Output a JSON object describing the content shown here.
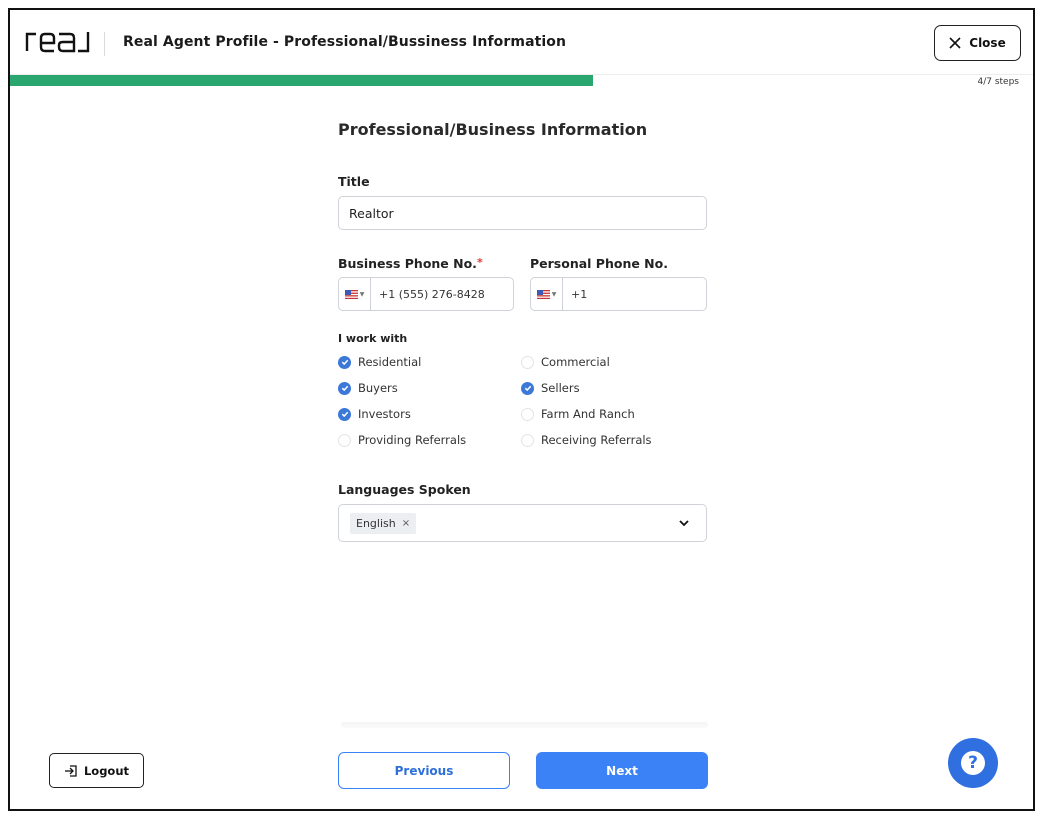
{
  "header": {
    "logo_text": "real",
    "title": "Real Agent Profile - Professional/Bussiness Information",
    "close_label": "Close"
  },
  "progress": {
    "current_step": 4,
    "total_steps": 7,
    "label": "4/7 steps",
    "fraction": 0.57
  },
  "form": {
    "section_title": "Professional/Business Information",
    "title_field": {
      "label": "Title",
      "value": "Realtor"
    },
    "business_phone": {
      "label": "Business Phone No.",
      "required_mark": "*",
      "value": "+1 (555) 276-8428",
      "country": "US"
    },
    "personal_phone": {
      "label": "Personal Phone No.",
      "value": "+1",
      "country": "US"
    },
    "work_with": {
      "label": "I work with",
      "options": [
        {
          "label": "Residential",
          "checked": true
        },
        {
          "label": "Commercial",
          "checked": false
        },
        {
          "label": "Buyers",
          "checked": true
        },
        {
          "label": "Sellers",
          "checked": true
        },
        {
          "label": "Investors",
          "checked": true
        },
        {
          "label": "Farm And Ranch",
          "checked": false
        },
        {
          "label": "Providing Referrals",
          "checked": false
        },
        {
          "label": "Receiving Referrals",
          "checked": false
        }
      ]
    },
    "languages": {
      "label": "Languages Spoken",
      "selected": [
        "English"
      ],
      "remove_glyph": "×"
    }
  },
  "footer": {
    "logout_label": "Logout",
    "previous_label": "Previous",
    "next_label": "Next",
    "help_glyph": "?"
  },
  "colors": {
    "progress": "#2aa66f",
    "primary": "#3b82f6",
    "checkbox": "#3b78d8",
    "required": "#e53935"
  },
  "icons": [
    "real-logo",
    "close-icon",
    "us-flag-icon",
    "chevron-down-icon",
    "logout-icon",
    "help-icon",
    "check-icon"
  ]
}
